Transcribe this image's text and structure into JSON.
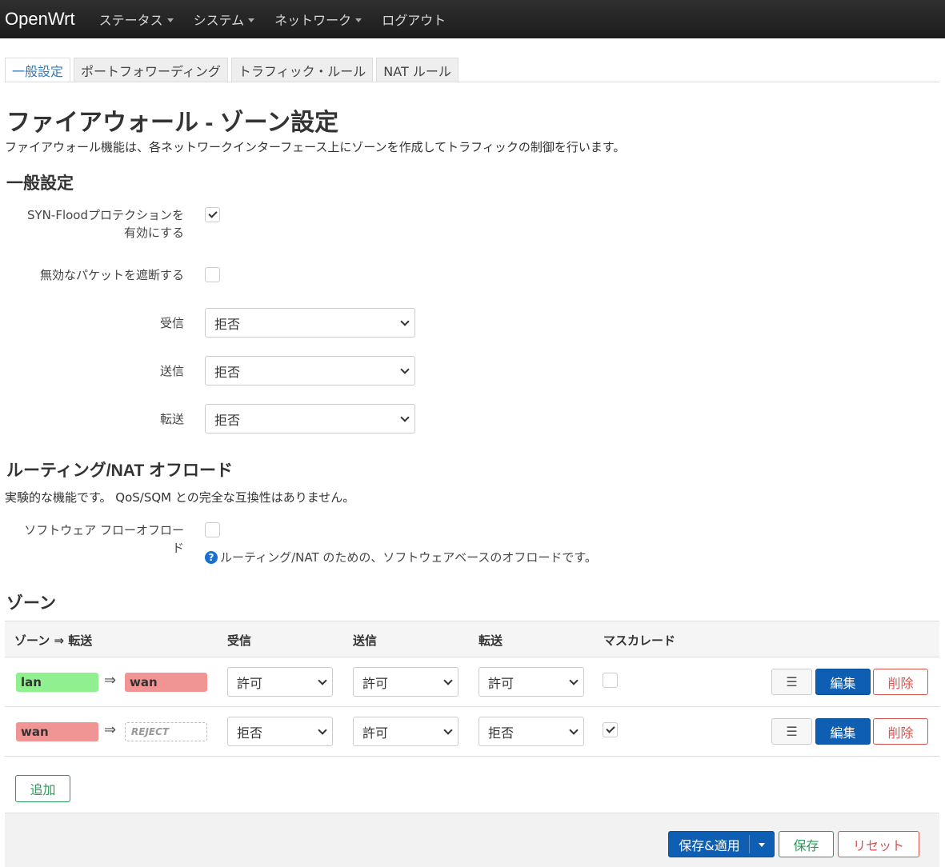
{
  "navbar": {
    "brand": "OpenWrt",
    "menu": [
      {
        "label": "ステータス",
        "dropdown": true
      },
      {
        "label": "システム",
        "dropdown": true
      },
      {
        "label": "ネットワーク",
        "dropdown": true
      },
      {
        "label": "ログアウト",
        "dropdown": false
      }
    ]
  },
  "tabs": [
    {
      "label": "一般設定",
      "active": true
    },
    {
      "label": "ポートフォワーディング",
      "active": false
    },
    {
      "label": "トラフィック・ルール",
      "active": false
    },
    {
      "label": "NAT ルール",
      "active": false
    }
  ],
  "page": {
    "title": "ファイアウォール - ゾーン設定",
    "description": "ファイアウォール機能は、各ネットワークインターフェース上にゾーンを作成してトラフィックの制御を行います。"
  },
  "general": {
    "heading": "一般設定",
    "syn_flood": {
      "label_line1": "SYN-Floodプロテクションを",
      "label_line2": "有効にする",
      "checked": true
    },
    "drop_invalid": {
      "label": "無効なパケットを遮断する",
      "checked": false
    },
    "input": {
      "label": "受信",
      "value": "拒否"
    },
    "output": {
      "label": "送信",
      "value": "拒否"
    },
    "forward": {
      "label": "転送",
      "value": "拒否"
    }
  },
  "offload": {
    "heading": "ルーティング/NAT オフロード",
    "description": "実験的な機能です。 QoS/SQM との完全な互換性はありません。",
    "software_offload": {
      "label_line1": "ソフトウェア フローオフロー",
      "label_line2": "ド",
      "checked": false,
      "help": "ルーティング/NAT のための、ソフトウェアベースのオフロードです。"
    }
  },
  "zones": {
    "heading": "ゾーン",
    "columns": {
      "zone_forward": "ゾーン ⇒ 転送",
      "input": "受信",
      "output": "送信",
      "forward": "転送",
      "masquerade": "マスカレード"
    },
    "arrow": "⇒",
    "rows": [
      {
        "zone": "lan",
        "zone_color": "#90f090",
        "dest": "wan",
        "dest_color": "#f09494",
        "dest_reject": false,
        "input": "許可",
        "output": "許可",
        "forward": "許可",
        "masquerade": false
      },
      {
        "zone": "wan",
        "zone_color": "#f09494",
        "dest": "REJECT",
        "dest_color": "#ffffff",
        "dest_reject": true,
        "input": "拒否",
        "output": "許可",
        "forward": "拒否",
        "masquerade": true
      }
    ],
    "menu_glyph": "☰",
    "edit_label": "編集",
    "delete_label": "削除",
    "add_label": "追加"
  },
  "footer": {
    "apply_label": "保存&適用",
    "save_label": "保存",
    "reset_label": "リセット"
  },
  "colors": {
    "primary": "#0e5fb3",
    "success": "#2a9a5a",
    "danger": "#d9534f",
    "link": "#337ab7"
  }
}
